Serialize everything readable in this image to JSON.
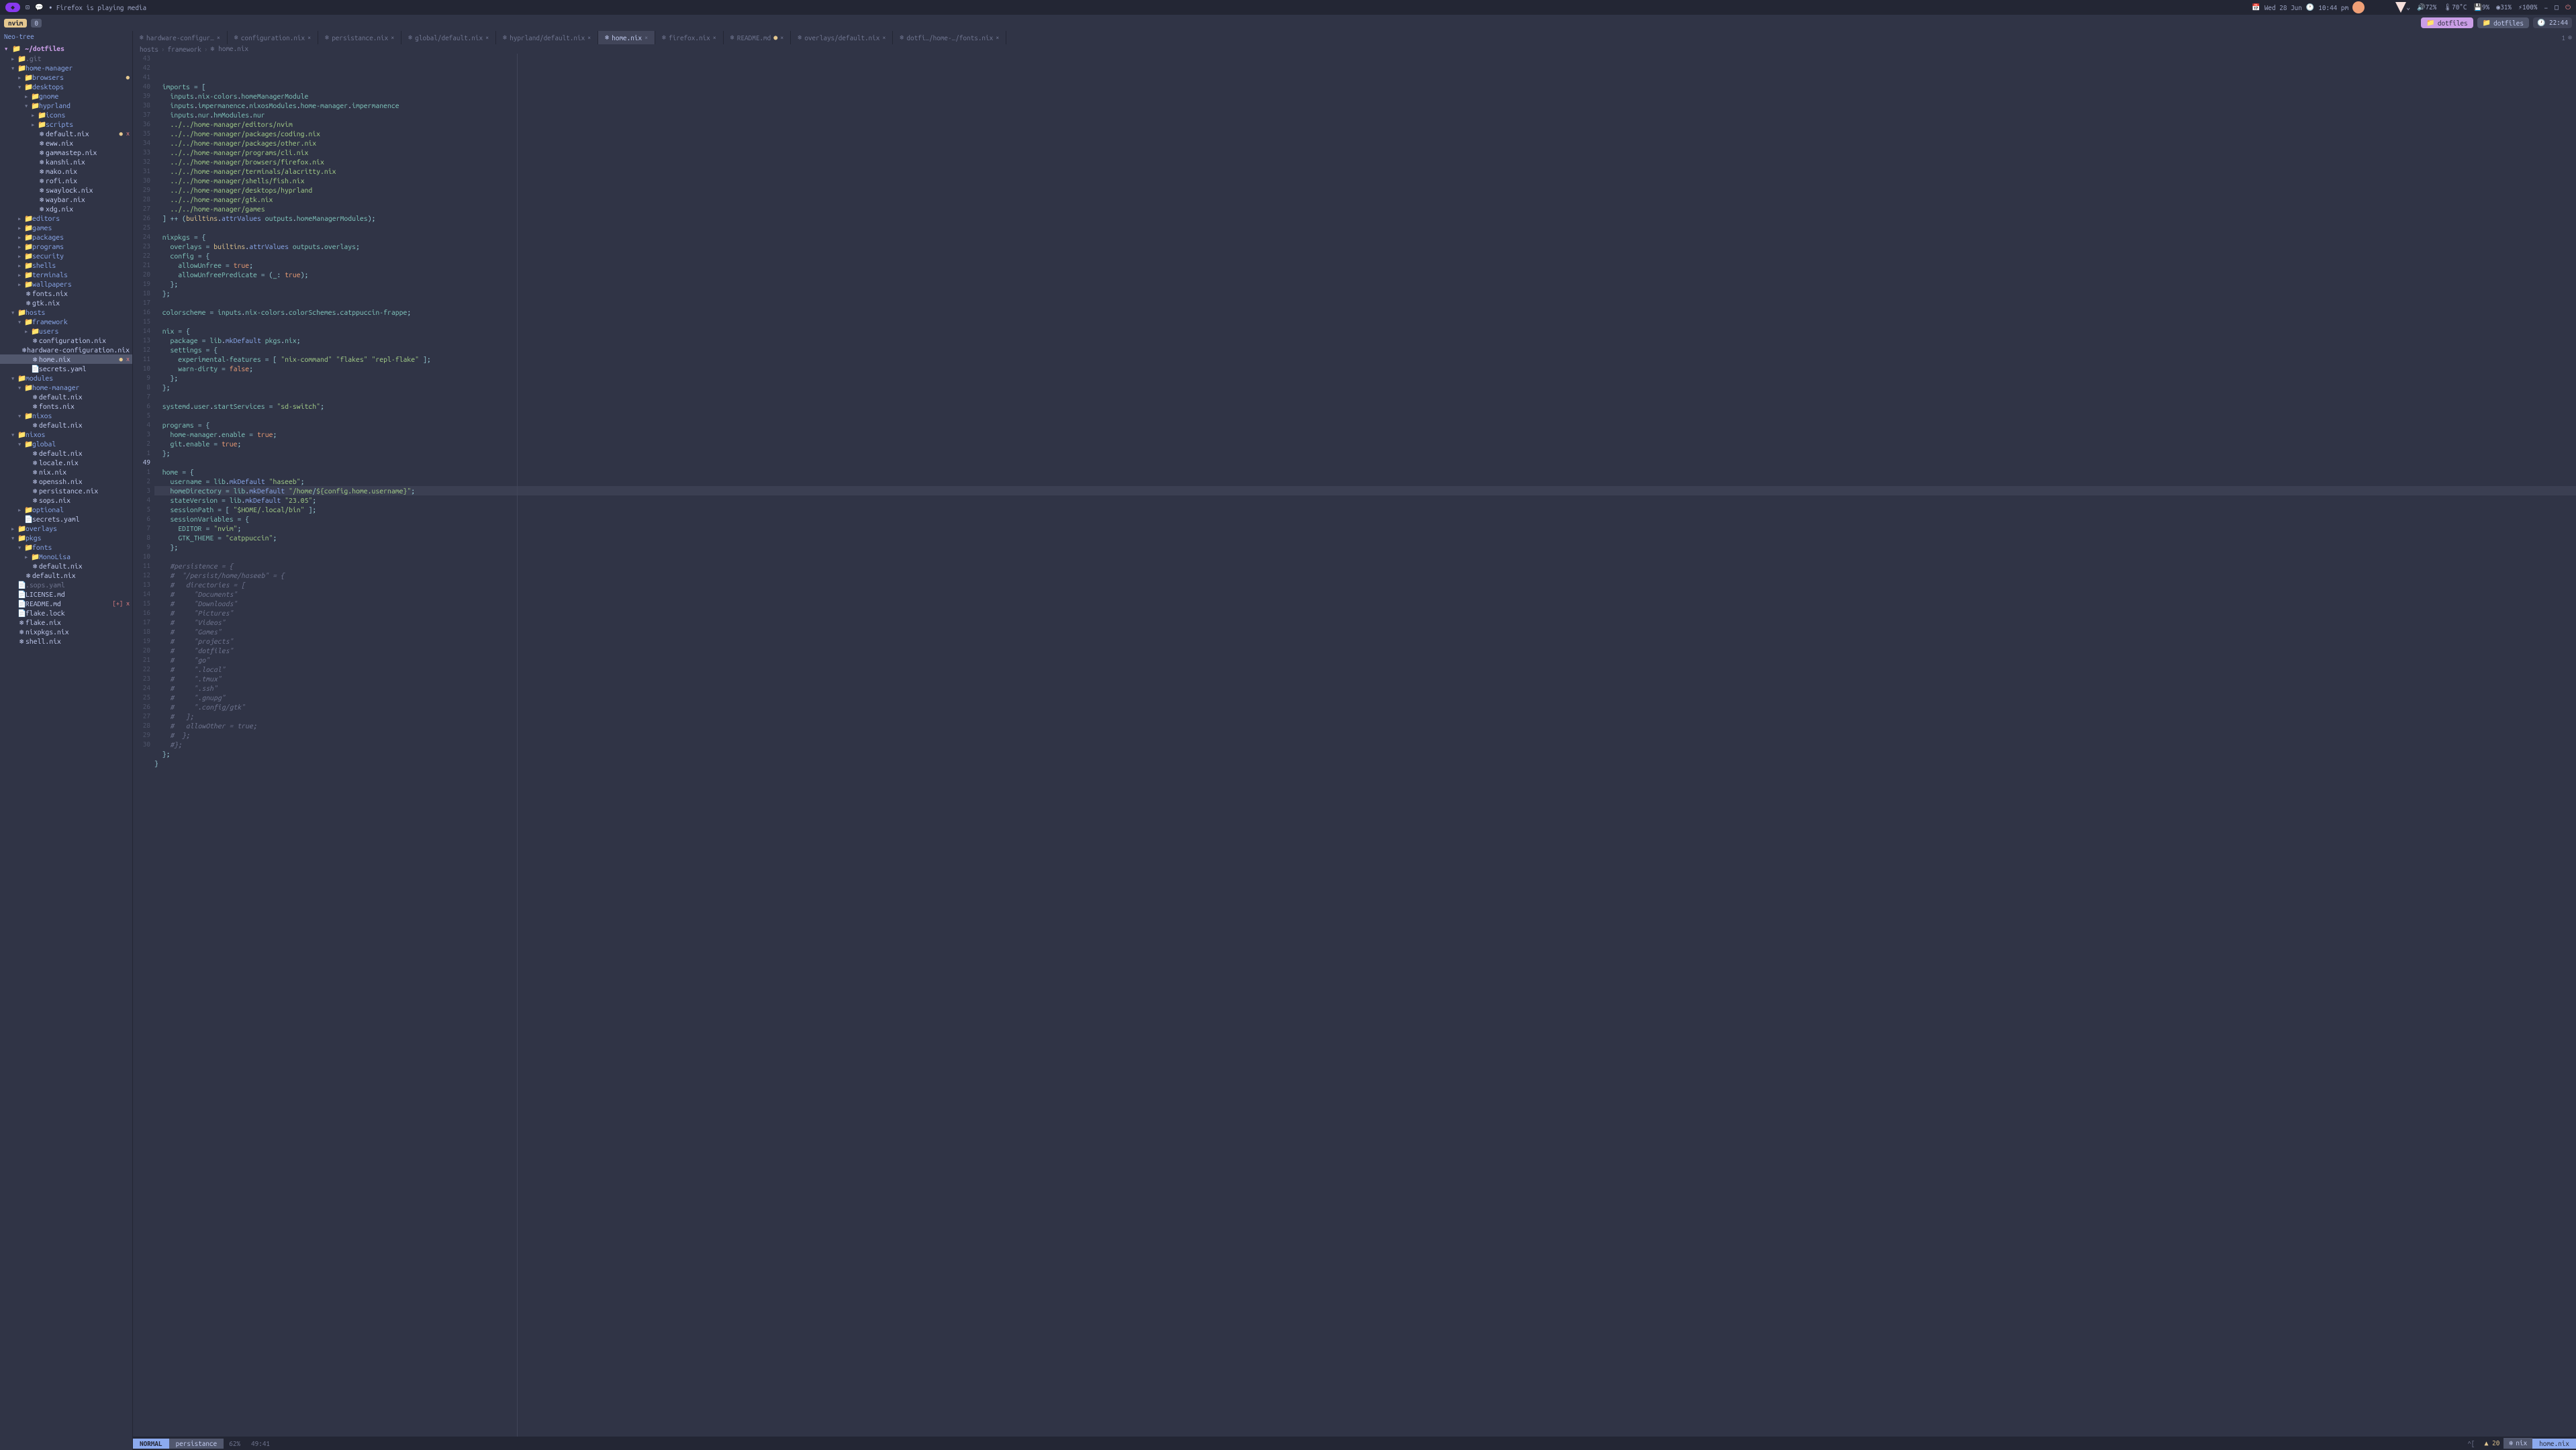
{
  "titlebar": {
    "firefox_playing": "• Firefox is playing media",
    "date": "Wed 28 Jun",
    "time": "10:44 pm",
    "vol": "72%",
    "temp": "70°C",
    "disk": "9%",
    "mem": "31%",
    "bat": "100%"
  },
  "tabbar": {
    "app": "nvim",
    "count": "0",
    "session_active": "dotfiles",
    "session_inactive": "dotfiles",
    "clock": "22:44"
  },
  "sidebar": {
    "title": "Neo-tree",
    "root": "~/dotfiles",
    "items": [
      {
        "d": 0,
        "t": "dir",
        "n": ".git",
        "c": "▸",
        "hidden": true
      },
      {
        "d": 0,
        "t": "dir",
        "n": "home-manager",
        "c": "▾"
      },
      {
        "d": 1,
        "t": "dir",
        "n": "browsers",
        "c": "▸",
        "marks": "●"
      },
      {
        "d": 1,
        "t": "dir",
        "n": "desktops",
        "c": "▾"
      },
      {
        "d": 2,
        "t": "dir",
        "n": "gnome",
        "c": "▸"
      },
      {
        "d": 2,
        "t": "dir",
        "n": "hyprland",
        "c": "▾"
      },
      {
        "d": 3,
        "t": "dir",
        "n": "icons",
        "c": "▸"
      },
      {
        "d": 3,
        "t": "dir",
        "n": "scripts",
        "c": "▸"
      },
      {
        "d": 3,
        "t": "nix",
        "n": "default.nix",
        "marks": "● x"
      },
      {
        "d": 3,
        "t": "nix",
        "n": "eww.nix"
      },
      {
        "d": 3,
        "t": "nix",
        "n": "gammastep.nix"
      },
      {
        "d": 3,
        "t": "nix",
        "n": "kanshi.nix"
      },
      {
        "d": 3,
        "t": "nix",
        "n": "mako.nix"
      },
      {
        "d": 3,
        "t": "nix",
        "n": "rofi.nix"
      },
      {
        "d": 3,
        "t": "nix",
        "n": "swaylock.nix"
      },
      {
        "d": 3,
        "t": "nix",
        "n": "waybar.nix"
      },
      {
        "d": 3,
        "t": "nix",
        "n": "xdg.nix"
      },
      {
        "d": 1,
        "t": "dir",
        "n": "editors",
        "c": "▸"
      },
      {
        "d": 1,
        "t": "dir",
        "n": "games",
        "c": "▸"
      },
      {
        "d": 1,
        "t": "dir",
        "n": "packages",
        "c": "▸"
      },
      {
        "d": 1,
        "t": "dir",
        "n": "programs",
        "c": "▸"
      },
      {
        "d": 1,
        "t": "dir",
        "n": "security",
        "c": "▸"
      },
      {
        "d": 1,
        "t": "dir",
        "n": "shells",
        "c": "▸"
      },
      {
        "d": 1,
        "t": "dir",
        "n": "terminals",
        "c": "▸"
      },
      {
        "d": 1,
        "t": "dir",
        "n": "wallpapers",
        "c": "▸"
      },
      {
        "d": 1,
        "t": "nix",
        "n": "fonts.nix"
      },
      {
        "d": 1,
        "t": "nix",
        "n": "gtk.nix"
      },
      {
        "d": 0,
        "t": "dir",
        "n": "hosts",
        "c": "▾"
      },
      {
        "d": 1,
        "t": "dir",
        "n": "framework",
        "c": "▾"
      },
      {
        "d": 2,
        "t": "dir",
        "n": "users",
        "c": "▸"
      },
      {
        "d": 2,
        "t": "nix",
        "n": "configuration.nix"
      },
      {
        "d": 2,
        "t": "nix",
        "n": "hardware-configuration.nix"
      },
      {
        "d": 2,
        "t": "nix",
        "n": "home.nix",
        "sel": true,
        "marks": "● x"
      },
      {
        "d": 2,
        "t": "file",
        "n": "secrets.yaml"
      },
      {
        "d": 0,
        "t": "dir",
        "n": "modules",
        "c": "▾"
      },
      {
        "d": 1,
        "t": "dir",
        "n": "home-manager",
        "c": "▾"
      },
      {
        "d": 2,
        "t": "nix",
        "n": "default.nix"
      },
      {
        "d": 2,
        "t": "nix",
        "n": "fonts.nix"
      },
      {
        "d": 1,
        "t": "dir",
        "n": "nixos",
        "c": "▾"
      },
      {
        "d": 2,
        "t": "nix",
        "n": "default.nix"
      },
      {
        "d": 0,
        "t": "dir",
        "n": "nixos",
        "c": "▾"
      },
      {
        "d": 1,
        "t": "dir",
        "n": "global",
        "c": "▾"
      },
      {
        "d": 2,
        "t": "nix",
        "n": "default.nix"
      },
      {
        "d": 2,
        "t": "nix",
        "n": "locale.nix"
      },
      {
        "d": 2,
        "t": "nix",
        "n": "nix.nix"
      },
      {
        "d": 2,
        "t": "nix",
        "n": "openssh.nix"
      },
      {
        "d": 2,
        "t": "nix",
        "n": "persistance.nix"
      },
      {
        "d": 2,
        "t": "nix",
        "n": "sops.nix"
      },
      {
        "d": 1,
        "t": "dir",
        "n": "optional",
        "c": "▸"
      },
      {
        "d": 1,
        "t": "file",
        "n": "secrets.yaml"
      },
      {
        "d": 0,
        "t": "dir",
        "n": "overlays",
        "c": "▸"
      },
      {
        "d": 0,
        "t": "dir",
        "n": "pkgs",
        "c": "▾"
      },
      {
        "d": 1,
        "t": "dir",
        "n": "fonts",
        "c": "▾"
      },
      {
        "d": 2,
        "t": "dir",
        "n": "MonoLisa",
        "c": "▸"
      },
      {
        "d": 2,
        "t": "nix",
        "n": "default.nix"
      },
      {
        "d": 1,
        "t": "nix",
        "n": "default.nix"
      },
      {
        "d": 0,
        "t": "file",
        "n": ".sops.yaml",
        "hidden": true
      },
      {
        "d": 0,
        "t": "file",
        "n": "LICENSE.md"
      },
      {
        "d": 0,
        "t": "file",
        "n": "README.md",
        "marks": "[+]  x"
      },
      {
        "d": 0,
        "t": "file",
        "n": "flake.lock"
      },
      {
        "d": 0,
        "t": "nix",
        "n": "flake.nix"
      },
      {
        "d": 0,
        "t": "nix",
        "n": "nixpkgs.nix"
      },
      {
        "d": 0,
        "t": "nix",
        "n": "shell.nix"
      }
    ]
  },
  "buffers": [
    {
      "name": "hardware-configur…",
      "close": "×"
    },
    {
      "name": "configuration.nix",
      "close": "×"
    },
    {
      "name": "persistance.nix",
      "close": "×"
    },
    {
      "name": "global/default.nix",
      "close": "×"
    },
    {
      "name": "hyprland/default.nix",
      "close": "×"
    },
    {
      "name": "home.nix",
      "active": true,
      "close": "×"
    },
    {
      "name": "firefox.nix",
      "close": "×"
    },
    {
      "name": "README.md",
      "dirty": true,
      "close": "×"
    },
    {
      "name": "overlays/default.nix",
      "close": "×"
    },
    {
      "name": "dotfi…/home-…/fonts.nix",
      "close": "×"
    }
  ],
  "buffers_right": {
    "tabnum": "1",
    "add": "⊗"
  },
  "breadcrumb": [
    "hosts",
    "framework",
    "home.nix"
  ],
  "gutter": [
    "43",
    "42",
    "41",
    "40",
    "39",
    "38",
    "37",
    "36",
    "35",
    "34",
    "33",
    "32",
    "31",
    "30",
    "29",
    "28",
    "27",
    "26",
    "25",
    "24",
    "23",
    "22",
    "21",
    "20",
    "19",
    "18",
    "17",
    "16",
    "15",
    "14",
    "13",
    "12",
    "11",
    "10",
    "9",
    "8",
    "7",
    "6",
    "5",
    "4",
    "3",
    "2",
    "1",
    "49",
    "1",
    "2",
    "3",
    "4",
    "5",
    "6",
    "7",
    "8",
    "9",
    "10",
    "11",
    "12",
    "13",
    "14",
    "15",
    "16",
    "17",
    "18",
    "19",
    "20",
    "21",
    "22",
    "23",
    "24",
    "25",
    "26",
    "27",
    "28",
    "29",
    "30"
  ],
  "code": [
    {
      "h": "  <span class='prop'>imports</span> <span class='op'>=</span> <span class='op'>[</span>"
    },
    {
      "h": "    <span class='prop'>inputs</span>.<span class='prop'>nix-colors</span>.<span class='prop'>homeManagerModule</span>"
    },
    {
      "h": "    <span class='prop'>inputs</span>.<span class='prop'>impermanence</span>.<span class='prop'>nixosModules</span>.<span class='prop'>home-manager</span>.<span class='prop'>impermanence</span>"
    },
    {
      "h": "    <span class='prop'>inputs</span>.<span class='prop'>nur</span>.<span class='prop'>hmModules</span>.<span class='prop'>nur</span>"
    },
    {
      "h": "    <span class='str'>../../home-manager/editors/nvim</span>"
    },
    {
      "h": "    <span class='str'>../../home-manager/packages/coding.nix</span>"
    },
    {
      "h": "    <span class='str'>../../home-manager/packages/other.nix</span>"
    },
    {
      "h": "    <span class='str'>../../home-manager/programs/cli.nix</span>"
    },
    {
      "h": "    <span class='str'>../../home-manager/browsers/firefox.nix</span>"
    },
    {
      "h": "    <span class='str'>../../home-manager/terminals/alacritty.nix</span>"
    },
    {
      "h": "    <span class='str'>../../home-manager/shells/fish.nix</span>"
    },
    {
      "h": "    <span class='str'>../../home-manager/desktops/hyprland</span>"
    },
    {
      "h": "    <span class='str'>../../home-manager/gtk.nix</span>"
    },
    {
      "h": "    <span class='str'>../../home-manager/games</span>"
    },
    {
      "h": "  <span class='op'>]</span> <span class='op'>++</span> <span class='op'>(</span><span class='builtin'>builtins</span>.<span class='fn'>attrValues</span> <span class='prop'>outputs</span>.<span class='prop'>homeManagerModules</span><span class='op'>);</span>"
    },
    {
      "h": ""
    },
    {
      "h": "  <span class='prop'>nixpkgs</span> <span class='op'>=</span> <span class='op'>{</span>"
    },
    {
      "h": "    <span class='prop'>overlays</span> <span class='op'>=</span> <span class='builtin'>builtins</span>.<span class='fn'>attrValues</span> <span class='prop'>outputs</span>.<span class='prop'>overlays</span><span class='op'>;</span>"
    },
    {
      "h": "    <span class='prop'>config</span> <span class='op'>=</span> <span class='op'>{</span>"
    },
    {
      "h": "      <span class='prop'>allowUnfree</span> <span class='op'>=</span> <span class='bool'>true</span><span class='op'>;</span>"
    },
    {
      "h": "      <span class='prop'>allowUnfreePredicate</span> <span class='op'>=</span> <span class='op'>(</span><span class='prop'>_</span><span class='op'>:</span> <span class='bool'>true</span><span class='op'>);</span>"
    },
    {
      "h": "    <span class='op'>};</span>"
    },
    {
      "h": "  <span class='op'>};</span>"
    },
    {
      "h": ""
    },
    {
      "h": "  <span class='prop'>colorscheme</span> <span class='op'>=</span> <span class='prop'>inputs</span>.<span class='prop'>nix-colors</span>.<span class='prop'>colorSchemes</span>.<span class='prop'>catppuccin-frappe</span><span class='op'>;</span>"
    },
    {
      "h": ""
    },
    {
      "h": "  <span class='prop'>nix</span> <span class='op'>=</span> <span class='op'>{</span>"
    },
    {
      "h": "    <span class='prop'>package</span> <span class='op'>=</span> <span class='prop'>lib</span>.<span class='fn'>mkDefault</span> <span class='prop'>pkgs</span>.<span class='prop'>nix</span><span class='op'>;</span>"
    },
    {
      "h": "    <span class='prop'>settings</span> <span class='op'>=</span> <span class='op'>{</span>"
    },
    {
      "h": "      <span class='prop'>experimental-features</span> <span class='op'>=</span> <span class='op'>[</span> <span class='str'>\"nix-command\"</span> <span class='str'>\"flakes\"</span> <span class='str'>\"repl-flake\"</span> <span class='op'>];</span>"
    },
    {
      "h": "      <span class='prop'>warn-dirty</span> <span class='op'>=</span> <span class='bool'>false</span><span class='op'>;</span>"
    },
    {
      "h": "    <span class='op'>};</span>"
    },
    {
      "h": "  <span class='op'>};</span>"
    },
    {
      "h": ""
    },
    {
      "h": "  <span class='prop'>systemd</span>.<span class='prop'>user</span>.<span class='prop'>startServices</span> <span class='op'>=</span> <span class='str'>\"sd-switch\"</span><span class='op'>;</span>"
    },
    {
      "h": ""
    },
    {
      "h": "  <span class='prop'>programs</span> <span class='op'>=</span> <span class='op'>{</span>"
    },
    {
      "h": "    <span class='prop'>home-manager</span>.<span class='prop'>enable</span> <span class='op'>=</span> <span class='bool'>true</span><span class='op'>;</span>"
    },
    {
      "h": "    <span class='prop'>git</span>.<span class='prop'>enable</span> <span class='op'>=</span> <span class='bool'>true</span><span class='op'>;</span>"
    },
    {
      "h": "  <span class='op'>};</span>"
    },
    {
      "h": ""
    },
    {
      "h": "  <span class='prop'>home</span> <span class='op'>=</span> <span class='op'>{</span>"
    },
    {
      "h": "    <span class='prop'>username</span> <span class='op'>=</span> <span class='prop'>lib</span>.<span class='fn'>mkDefault</span> <span class='str'>\"haseeb\"</span><span class='op'>;</span>"
    },
    {
      "h": "    <span class='prop'>homeDirectory</span> <span class='op'>=</span> <span class='prop'>lib</span>.<span class='fn'>mkDefault</span> <span class='str'>\"/home</span><span class='op'>/</span><span class='str'>${config.home.username}\"</span><span class='op'>;</span>",
      "cur": true
    },
    {
      "h": "    <span class='prop'>stateVersion</span> <span class='op'>=</span> <span class='prop'>lib</span>.<span class='fn'>mkDefault</span> <span class='str'>\"23.05\"</span><span class='op'>;</span>"
    },
    {
      "h": "    <span class='prop'>sessionPath</span> <span class='op'>=</span> <span class='op'>[</span> <span class='str'>\"$HOME/.local/bin\"</span> <span class='op'>];</span>"
    },
    {
      "h": "    <span class='prop'>sessionVariables</span> <span class='op'>=</span> <span class='op'>{</span>"
    },
    {
      "h": "      <span class='prop'>EDITOR</span> <span class='op'>=</span> <span class='str'>\"nvim\"</span><span class='op'>;</span>"
    },
    {
      "h": "      <span class='prop'>GTK_THEME</span> <span class='op'>=</span> <span class='str'>\"catppuccin\"</span><span class='op'>;</span>"
    },
    {
      "h": "    <span class='op'>};</span>"
    },
    {
      "h": ""
    },
    {
      "h": "    <span class='comment'>#persistence = {</span>"
    },
    {
      "h": "    <span class='comment'>#  \"/persist/home/haseeb\" = {</span>"
    },
    {
      "h": "    <span class='comment'>#   directories = [</span>"
    },
    {
      "h": "    <span class='comment'>#     \"Documents\"</span>"
    },
    {
      "h": "    <span class='comment'>#     \"Downloads\"</span>"
    },
    {
      "h": "    <span class='comment'>#     \"Pictures\"</span>"
    },
    {
      "h": "    <span class='comment'>#     \"Videos\"</span>"
    },
    {
      "h": "    <span class='comment'>#     \"Games\"</span>"
    },
    {
      "h": "    <span class='comment'>#     \"projects\"</span>"
    },
    {
      "h": "    <span class='comment'>#     \"dotfiles\"</span>"
    },
    {
      "h": "    <span class='comment'>#     \"go\"</span>"
    },
    {
      "h": "    <span class='comment'>#     \".local\"</span>"
    },
    {
      "h": "    <span class='comment'>#     \".tmux\"</span>"
    },
    {
      "h": "    <span class='comment'>#     \".ssh\"</span>"
    },
    {
      "h": "    <span class='comment'>#     \".gnupg\"</span>"
    },
    {
      "h": "    <span class='comment'>#     \".config/gtk\"</span>"
    },
    {
      "h": "    <span class='comment'>#   ];</span>"
    },
    {
      "h": "    <span class='comment'>#   allowOther = true;</span>"
    },
    {
      "h": "    <span class='comment'>#  };</span>"
    },
    {
      "h": "    <span class='comment'>#};</span>"
    },
    {
      "h": "  <span class='op'>};</span>"
    },
    {
      "h": "<span class='op'>}</span>"
    },
    {
      "h": ""
    }
  ],
  "statusline": {
    "mode": "NORMAL",
    "branch": "persistance",
    "percent": "62%",
    "pos": "49:41",
    "recording": "^[",
    "diag_warn": "20",
    "filetype": "nix",
    "filename": "home.nix"
  }
}
